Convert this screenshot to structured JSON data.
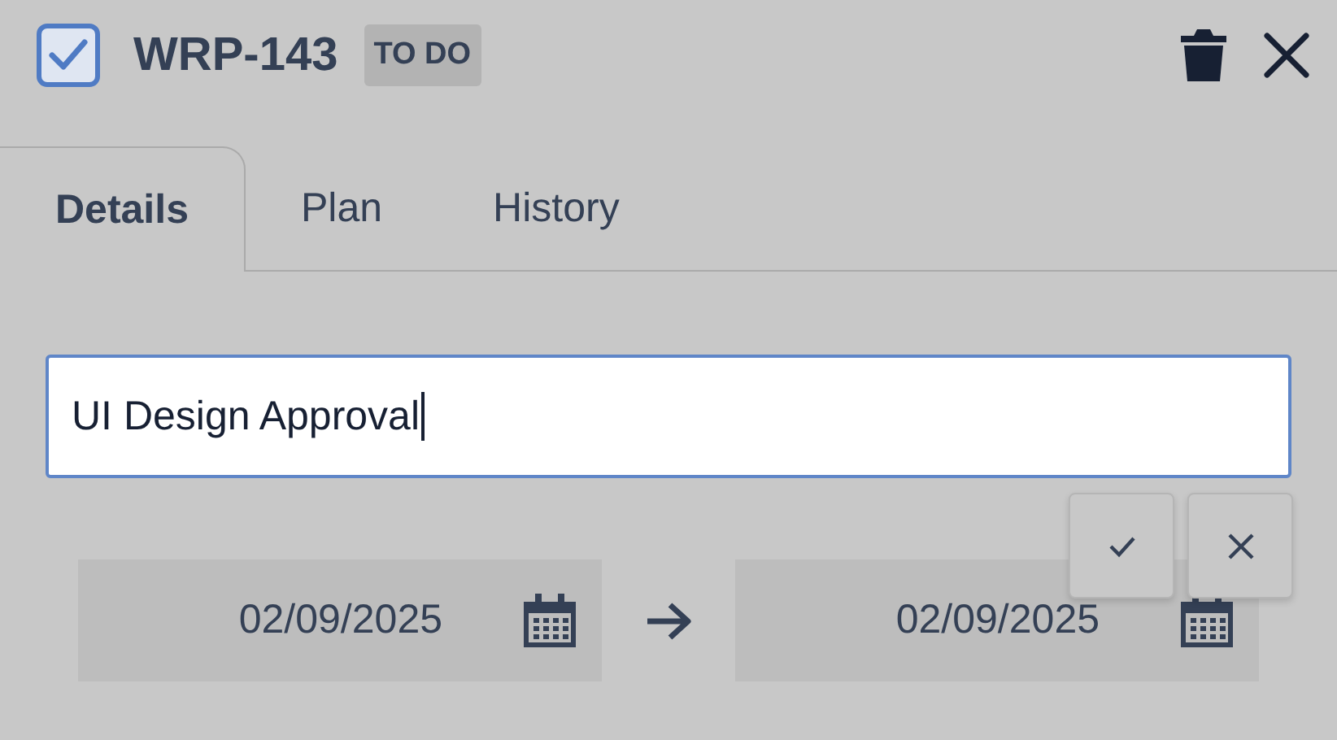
{
  "header": {
    "checked": true,
    "key": "WRP-143",
    "status": "TO DO"
  },
  "tabs": [
    {
      "label": "Details",
      "selected": true
    },
    {
      "label": "Plan",
      "selected": false
    },
    {
      "label": "History",
      "selected": false
    }
  ],
  "title_field": {
    "value": "UI Design Approval"
  },
  "dates": {
    "start": "02/09/2025",
    "end": "02/09/2025"
  }
}
